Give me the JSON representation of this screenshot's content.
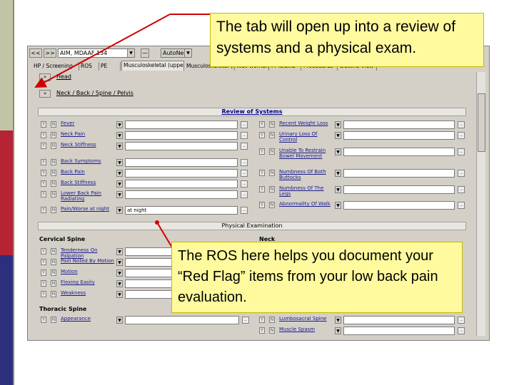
{
  "toolbar": {
    "back": "<<",
    "forward": ">>",
    "patient": "AIM, MDAAF 134",
    "minus": "—",
    "autoneg": "AutoNeg"
  },
  "tabs": [
    "HP / Screening",
    "ROS",
    "PE",
    "Musculoskeletal (upper)",
    "Musculoskeletal (lower)",
    "Well woman",
    "PFTs/EKG",
    "Procedures",
    "Outline View"
  ],
  "sections": {
    "head": "Head",
    "neck_back": "Neck / Back / Spine / Pelvis",
    "ros": "Review of Systems",
    "pe": "Physical Examination",
    "cervical": "Cervical Spine",
    "neck": "Neck",
    "thoracic": "Thoracic Spine"
  },
  "ros_left": [
    {
      "label": "Fever",
      "value": ""
    },
    {
      "label": "Neck Pain",
      "value": ""
    },
    {
      "label": "Neck Stiffness",
      "value": ""
    },
    {
      "label": "Back Symptoms",
      "value": ""
    },
    {
      "label": "Back Pain",
      "value": ""
    },
    {
      "label": "Back Stiffness",
      "value": ""
    },
    {
      "label": "Lower Back Pain Radiating",
      "value": ""
    },
    {
      "label": "Pain/Worse at night",
      "value": "at night"
    }
  ],
  "ros_right": [
    {
      "label": "Recent Weight Loss",
      "value": ""
    },
    {
      "label": "Urinary Loss Of Control",
      "value": ""
    },
    {
      "label": "Unable To Restrain Bowel Movement",
      "value": ""
    },
    {
      "label": "Numbness Of Both Buttocks",
      "value": ""
    },
    {
      "label": "Numbness Of The Legs",
      "value": ""
    },
    {
      "label": "Abnormality Of Walk",
      "value": ""
    }
  ],
  "cervical_items": [
    "Tenderness On Palpation",
    "Pain Noted By Motion",
    "Motion",
    "Flexing Easily",
    "Weakness"
  ],
  "thoracic_items": [
    "Appearance"
  ],
  "right_items": [
    "Lumbosacral Spine",
    "Muscle Spasm"
  ],
  "yn": {
    "y": "Y",
    "n": "N"
  },
  "icon_text": "...",
  "callouts": {
    "top": "The tab will open up into a review of systems and a physical exam.",
    "bottom": "The ROS here helps you document your “Red Flag” items from your low back pain evaluation."
  },
  "colors": {
    "callout_bg": "#fffa9e",
    "arrow": "#d00000",
    "link_text": "#1a1a8c"
  }
}
